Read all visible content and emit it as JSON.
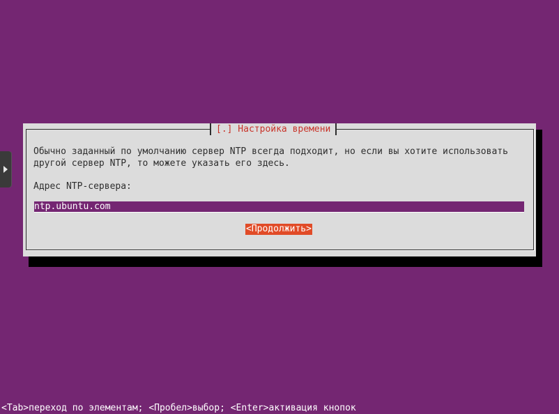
{
  "dialog": {
    "title": "[.] Настройка времени",
    "description_line1": "Обычно заданный по умолчанию сервер NTP всегда подходит, но если вы хотите использовать",
    "description_line2": "другой сервер NTP, то можете указать его здесь.",
    "field_label": "Адрес NTP-сервера:",
    "field_value": "ntp.ubuntu.com",
    "continue_label": "<Продолжить>"
  },
  "status_bar": {
    "text": "<Tab>переход по элементам; <Пробел>выбор; <Enter>активация кнопок"
  },
  "icons": {
    "side_tab": "chevron-right-icon"
  },
  "colors": {
    "background": "#742672",
    "dialog_bg": "#dcdcdc",
    "title_text": "#c8342a",
    "button_bg": "#e14b27",
    "field_bg": "#742672"
  }
}
